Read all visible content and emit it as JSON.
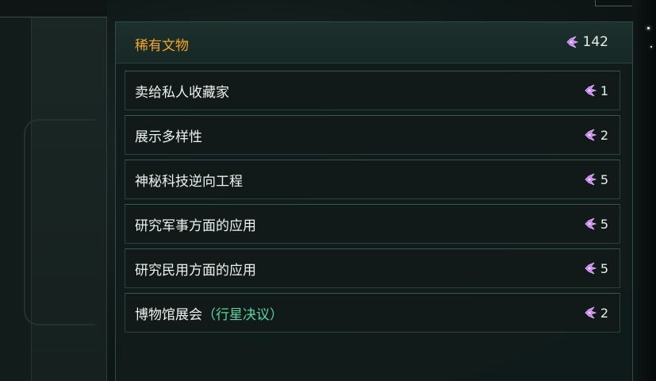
{
  "colors": {
    "title": "#f2a623",
    "resolution_tag": "#57d6a4",
    "artifact_icon": "#c77cf2"
  },
  "panel": {
    "title": "稀有文物",
    "total": "142",
    "icon": "minor-artifact-icon"
  },
  "options": [
    {
      "label": "卖给私人收藏家",
      "tag": "",
      "cost": "1",
      "icon": "minor-artifact-icon"
    },
    {
      "label": "展示多样性",
      "tag": "",
      "cost": "2",
      "icon": "minor-artifact-icon"
    },
    {
      "label": "神秘科技逆向工程",
      "tag": "",
      "cost": "5",
      "icon": "minor-artifact-icon"
    },
    {
      "label": "研究军事方面的应用",
      "tag": "",
      "cost": "5",
      "icon": "minor-artifact-icon"
    },
    {
      "label": "研究民用方面的应用",
      "tag": "",
      "cost": "5",
      "icon": "minor-artifact-icon"
    },
    {
      "label": "博物馆展会",
      "tag": "（行星决议）",
      "cost": "2",
      "icon": "minor-artifact-icon"
    }
  ]
}
